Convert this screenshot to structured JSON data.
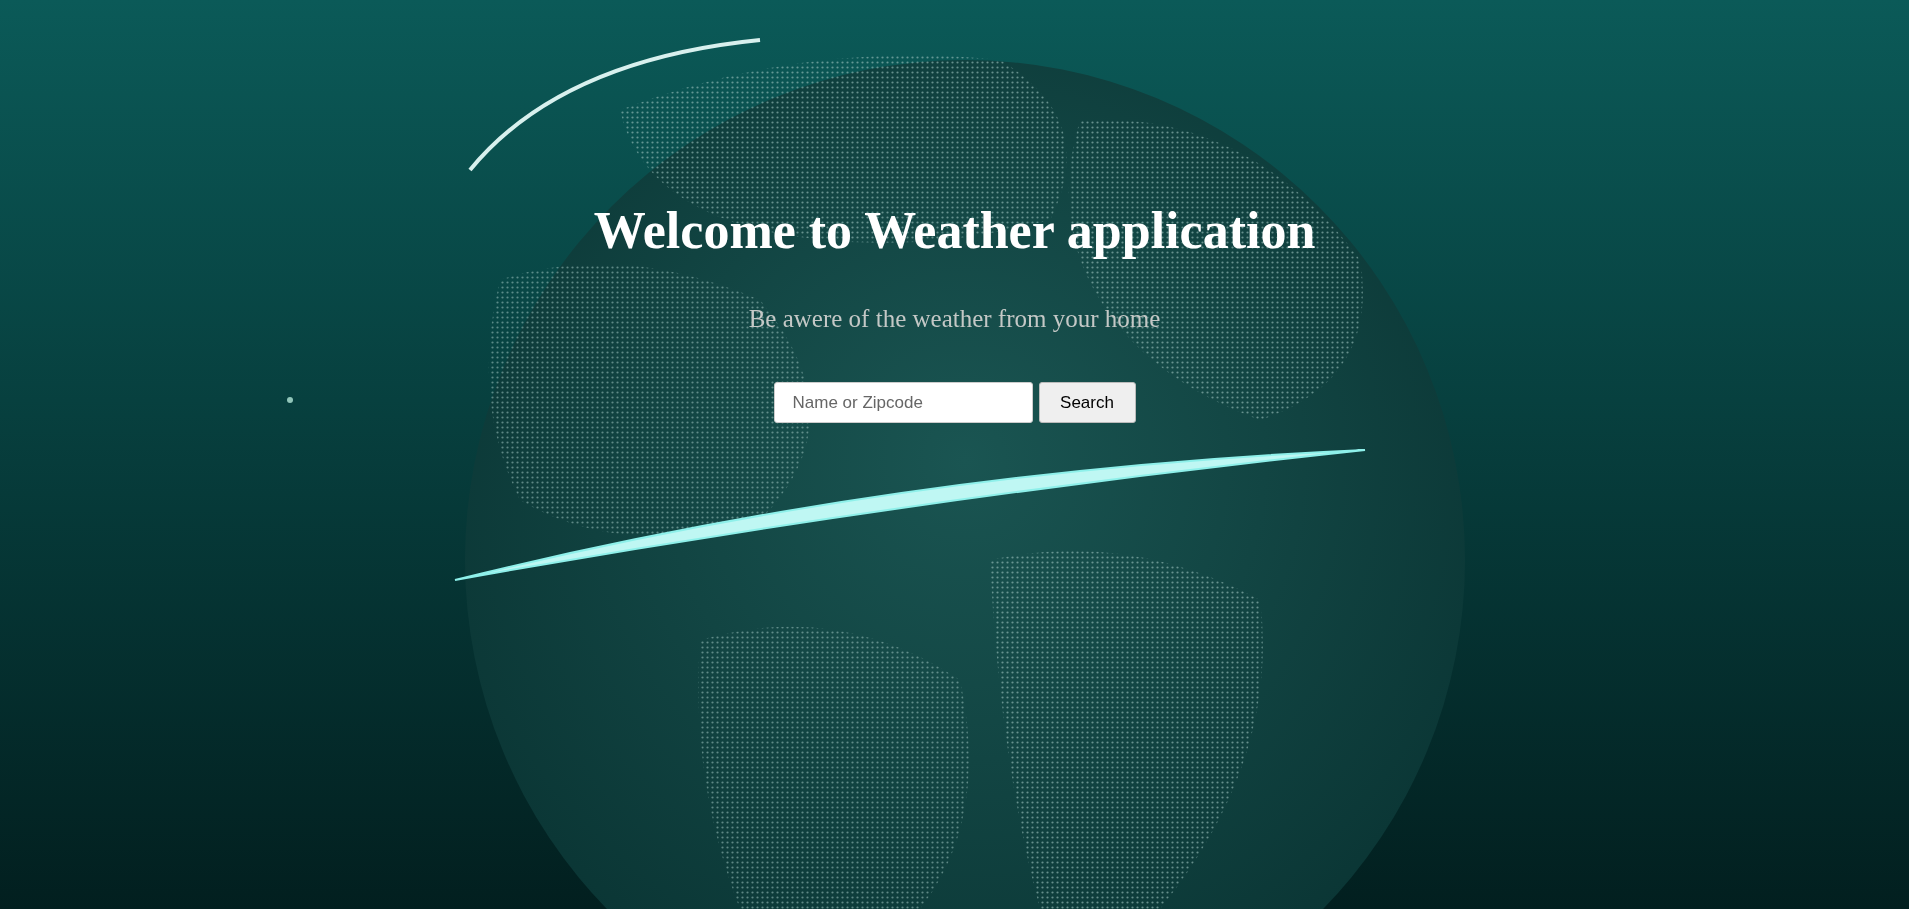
{
  "title": "Welcome to Weather application",
  "subtitle": "Be awere of the weather from your home",
  "search": {
    "placeholder": "Name or Zipcode",
    "button": "Search"
  }
}
